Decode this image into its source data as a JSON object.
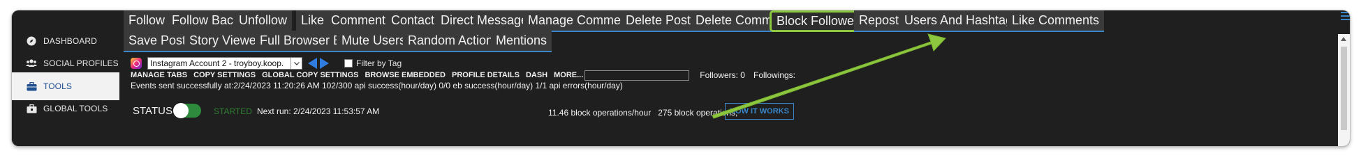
{
  "sidebar": {
    "items": [
      {
        "label": "DASHBOARD",
        "icon": "compass-icon"
      },
      {
        "label": "SOCIAL PROFILES",
        "icon": "users-icon"
      },
      {
        "label": "TOOLS",
        "icon": "briefcase-icon",
        "active": true
      },
      {
        "label": "GLOBAL TOOLS",
        "icon": "toolbox-icon"
      }
    ]
  },
  "tabs": {
    "row1": [
      "Follow",
      "Follow Back",
      "Unfollow",
      "Like",
      "Comment",
      "Contact",
      "Direct Messages",
      "Manage Comments",
      "Delete Posts",
      "Delete Comments",
      "Block Followers",
      "Repost",
      "Users And Hashtags",
      "Like Comments"
    ],
    "row2": [
      "Save Posts",
      "Story Viewer",
      "Full Browser Exp",
      "Mute Users",
      "Random Actions",
      "Mentions"
    ],
    "highlighted": "Block Followers"
  },
  "account": {
    "selected": "Instagram Account 2 - troyboy.koop.",
    "filter_label": "Filter by Tag"
  },
  "links": [
    "MANAGE TABS",
    "COPY SETTINGS",
    "GLOBAL COPY SETTINGS",
    "BROWSE EMBEDDED",
    "PROFILE DETAILS",
    "DASH",
    "MORE..."
  ],
  "stats": {
    "followers": "Followers: 0",
    "followings": "Followings:"
  },
  "events_text": "Events sent successfully at:2/24/2023 11:20:26 AM 102/300 api success(hour/day) 0/0 eb success(hour/day) 1/1 api errors(hour/day)",
  "status": {
    "label": "STATUS",
    "state": "STARTED",
    "next_run": "Next run: 2/24/2023 11:53:57 AM",
    "ops_rate": "11.46 block operations/hour",
    "ops_total": "275 block operations,",
    "how_button": "HOW IT WORKS"
  },
  "colors": {
    "accent": "#3a86c8",
    "highlight": "#8dc63f",
    "background": "#1f1f1f",
    "tab_bg": "#3a3a3a"
  }
}
